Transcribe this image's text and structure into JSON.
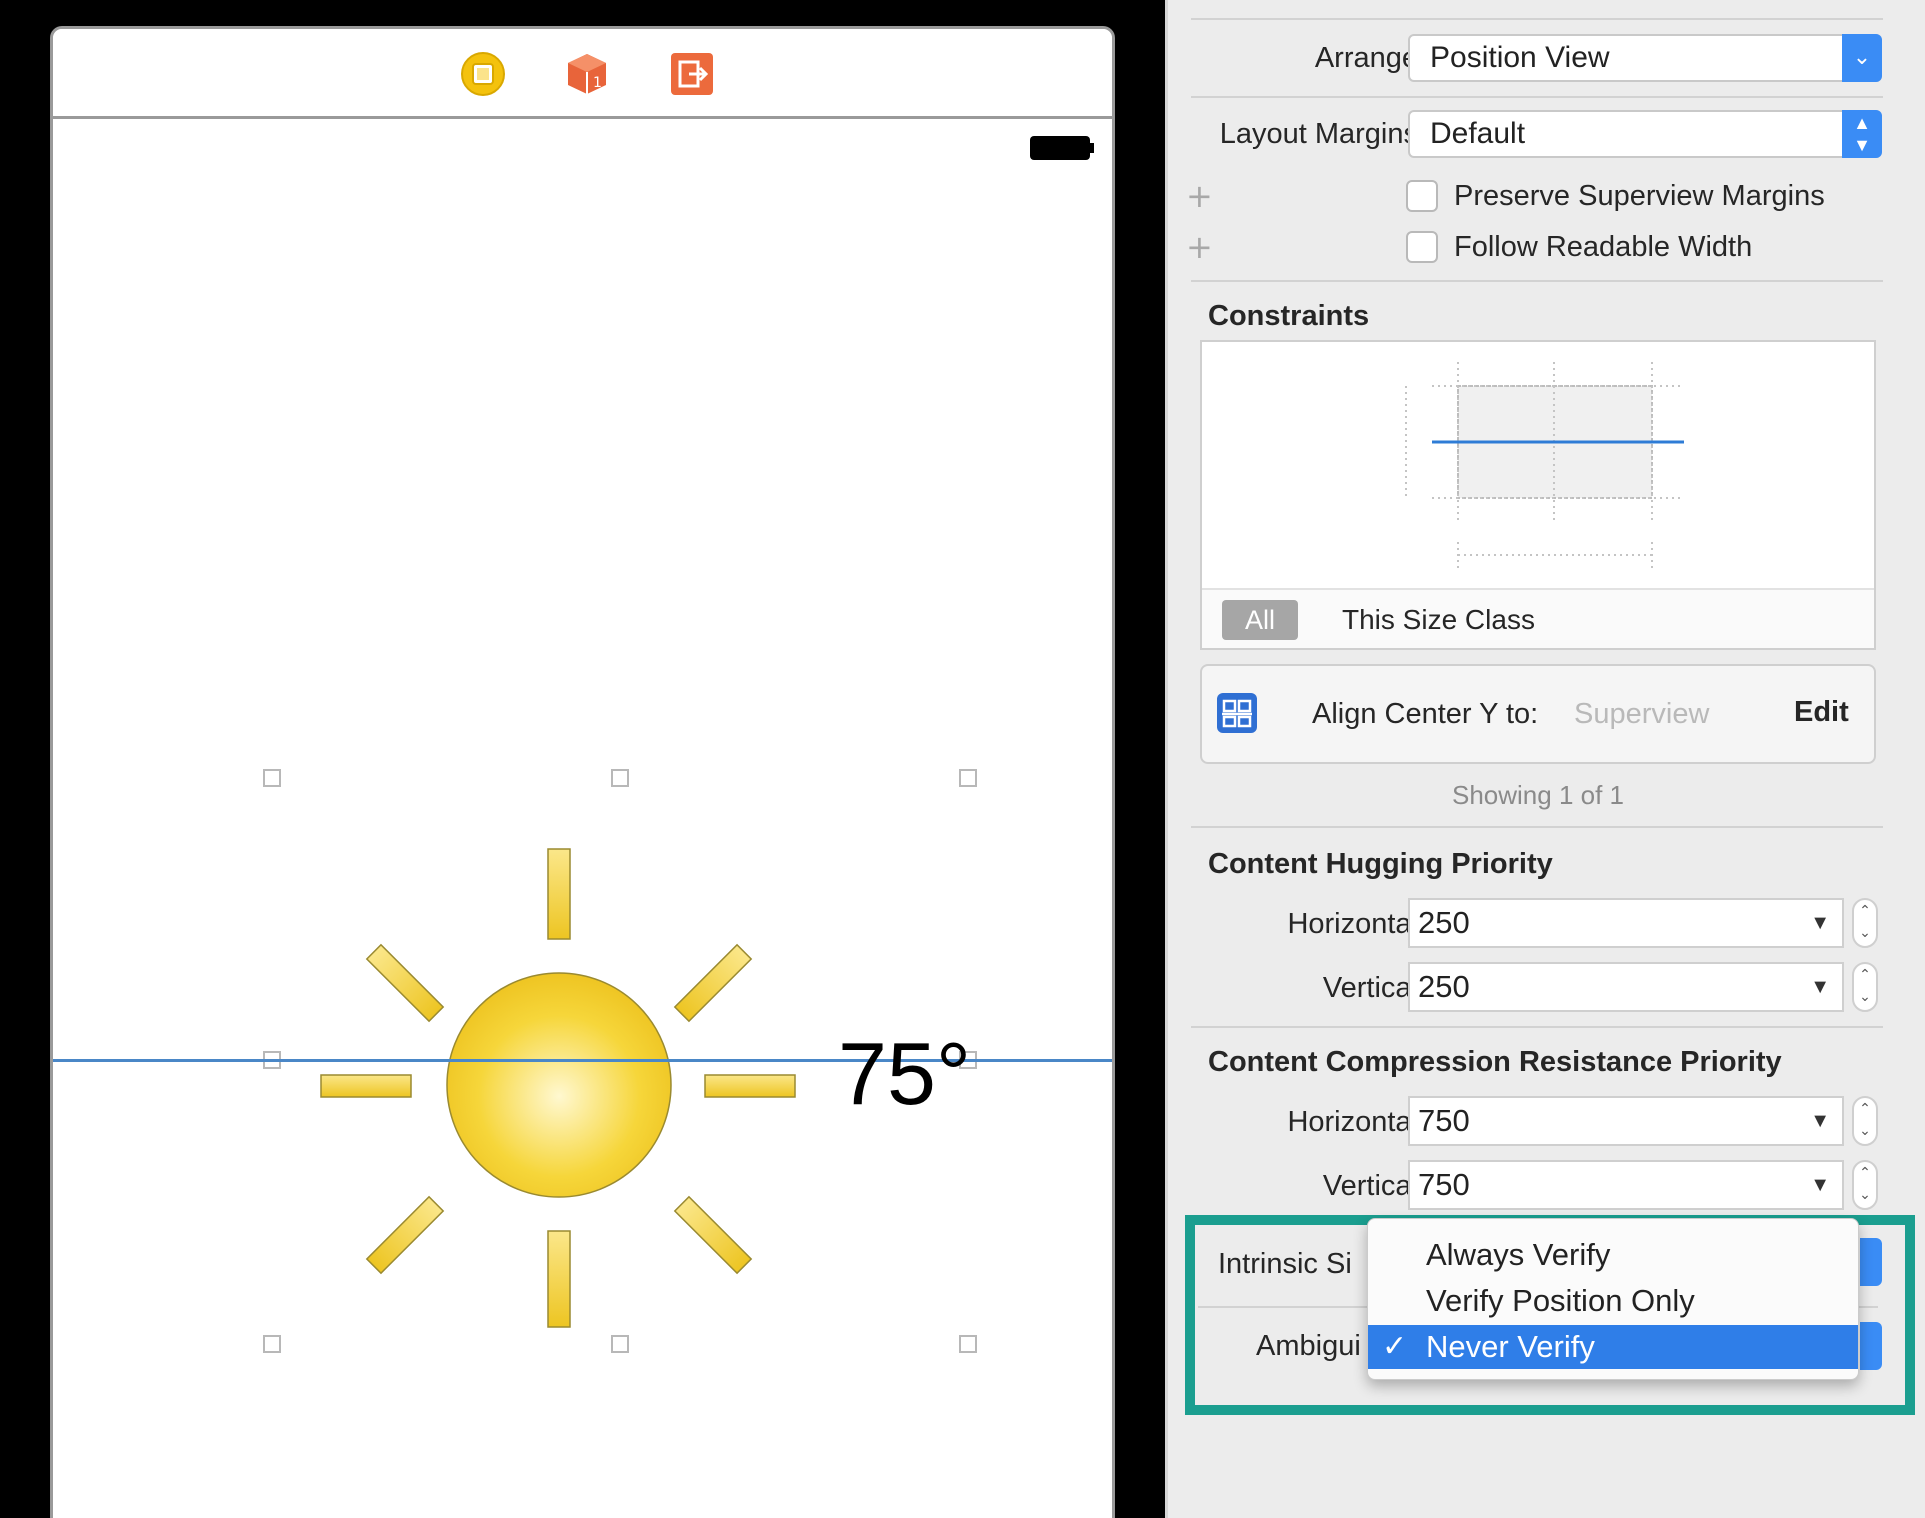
{
  "canvas": {
    "temperature_label": "75°",
    "toolbar_icons": [
      "view-controller-icon",
      "first-responder-icon",
      "exit-icon"
    ]
  },
  "inspector": {
    "arrange": {
      "label": "Arrange",
      "value": "Position View"
    },
    "layout_margins": {
      "label": "Layout Margins",
      "value": "Default"
    },
    "preserve_superview_margins": {
      "label": "Preserve Superview Margins",
      "checked": false
    },
    "follow_readable_width": {
      "label": "Follow Readable Width",
      "checked": false
    },
    "constraints": {
      "title": "Constraints",
      "tabs": [
        "All",
        "This Size Class"
      ],
      "selected_tab": "All",
      "items": [
        {
          "label": "Align Center Y to:",
          "target": "Superview",
          "action": "Edit"
        }
      ],
      "showing": "Showing 1 of 1"
    },
    "content_hugging": {
      "title": "Content Hugging Priority",
      "horizontal_label": "Horizontal",
      "horizontal_value": "250",
      "vertical_label": "Vertical",
      "vertical_value": "250"
    },
    "compression_resistance": {
      "title": "Content Compression Resistance Priority",
      "horizontal_label": "Horizontal",
      "horizontal_value": "750",
      "vertical_label": "Vertical",
      "vertical_value": "750"
    },
    "intrinsic_size": {
      "label": "Intrinsic Si"
    },
    "ambiguity": {
      "label": "Ambigui",
      "options": [
        "Always Verify",
        "Verify Position Only",
        "Never Verify"
      ],
      "selected": "Never Verify"
    }
  },
  "colors": {
    "accent": "#3a8cf5",
    "highlight_frame": "#1a9e8f",
    "guide_line": "#4a87c7",
    "sun_fill": "#f3d234"
  }
}
